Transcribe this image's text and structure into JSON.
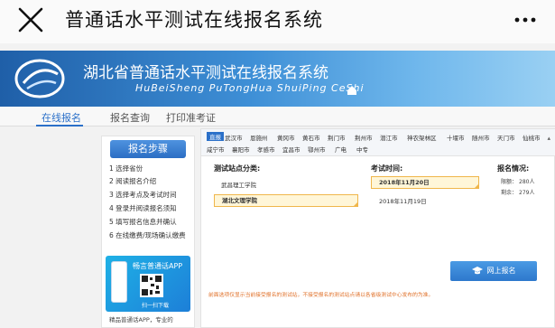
{
  "appbar": {
    "title": "普通话水平测试在线报名系统",
    "close_icon": "close-icon",
    "more_icon": "more-icon"
  },
  "banner": {
    "title_cn": "湖北省普通话水平测试在线报名系统",
    "title_en": "HuBeiSheng  PuTongHua ShuiPing CeShi"
  },
  "nav": {
    "tabs": [
      "在线报名",
      "报名查询",
      "打印准考证"
    ],
    "active": 0
  },
  "steps": {
    "button": "报名步骤",
    "items": [
      "1 选择省份",
      "2 阅读报名介绍",
      "3 选择考点及考试时间",
      "4 登录并阅读报名须知",
      "5 填写报名信息并确认",
      "6 在线缴费/现场确认缴费"
    ]
  },
  "app_ad": {
    "title": "畅言普通话APP",
    "scan": "扫一扫下载",
    "note": "精品普通话APP，专业的"
  },
  "cities": {
    "row1": [
      "直报",
      "武汉市",
      "恩施州",
      "黄冈市",
      "黄石市",
      "荆门市",
      "荆州市",
      "潜江市",
      "神农架林区",
      "十堰市",
      "随州市",
      "天门市",
      "仙桃市"
    ],
    "row2": [
      "咸宁市",
      "襄阳市",
      "孝感市",
      "宜昌市",
      "鄂州市",
      "广电",
      "中专"
    ],
    "selected": "直报"
  },
  "table": {
    "col_site": "测试站点分类:",
    "col_time": "考试时间:",
    "col_status": "报名情况:",
    "sites": [
      "武昌理工学院",
      "湖北文理学院"
    ],
    "times": [
      "2018年11月20日",
      "2018年11月19日"
    ],
    "status": [
      {
        "label": "限额：",
        "value": "280人"
      },
      {
        "label": "剩余：",
        "value": "279人"
      }
    ]
  },
  "signup_button": "网上报名",
  "warning": "前面选项仅显示当前接受报名的测试站，不接受报名的测试站点请以各省级测试中心发布的为准。",
  "colors": {
    "accent": "#2b70c9",
    "highlight": "#fff6d8",
    "highlight_border": "#f0b64b",
    "warning": "#e0712a"
  }
}
